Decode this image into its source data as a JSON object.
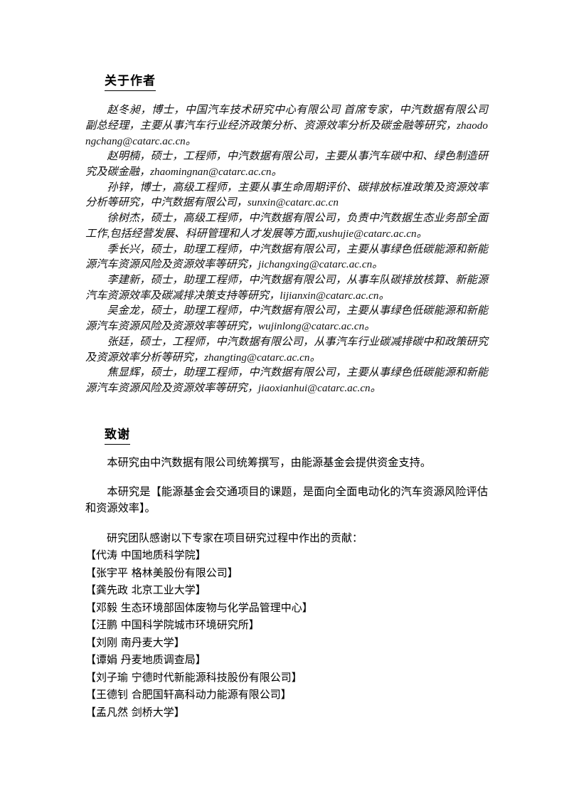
{
  "document": {
    "page_background": "#ffffff",
    "text_color": "#000000"
  },
  "about_authors": {
    "heading": "关于作者",
    "authors": [
      {
        "name": "赵冬昶",
        "text": "赵冬昶，博士，中国汽车技术研究中心有限公司 首席专家，中汽数据有限公司 副总经理，主要从事汽车行业经济政策分析、资源效率分析及碳金融等研究，zhaodongchang@catarc.ac.cn。"
      },
      {
        "name": "赵明楠",
        "text": "赵明楠，硕士，工程师，中汽数据有限公司，主要从事汽车碳中和、绿色制造研究及碳金融，zhaomingnan@catarc.ac.cn。"
      },
      {
        "name": "孙锌",
        "text": "孙锌，博士，高级工程师，主要从事生命周期评价、碳排放标准政策及资源效率分析等研究，中汽数据有限公司，sunxin@catarc.ac.cn"
      },
      {
        "name": "徐树杰",
        "text": "徐树杰，硕士，高级工程师，中汽数据有限公司，负责中汽数据生态业务部全面工作,包括经营发展、科研管理和人才发展等方面,xushujie@catarc.ac.cn。"
      },
      {
        "name": "季长兴",
        "text": "季长兴，硕士，助理工程师，中汽数据有限公司，主要从事绿色低碳能源和新能源汽车资源风险及资源效率等研究，jichangxing@catarc.ac.cn。"
      },
      {
        "name": "李建新",
        "text": "李建新，硕士，助理工程师，中汽数据有限公司，从事车队碳排放核算、新能源汽车资源效率及碳减排决策支持等研究，lijianxin@catarc.ac.cn。"
      },
      {
        "name": "吴金龙",
        "text": "吴金龙，硕士，助理工程师，中汽数据有限公司，主要从事绿色低碳能源和新能源汽车资源风险及资源效率等研究，wujinlong@catarc.ac.cn。"
      },
      {
        "name": "张廷",
        "text": "张廷，硕士，工程师，中汽数据有限公司，从事汽车行业碳减排碳中和政策研究及资源效率分析等研究，zhangting@catarc.ac.cn。"
      },
      {
        "name": "焦显辉",
        "text": "焦显辉，硕士，助理工程师，中汽数据有限公司，主要从事绿色低碳能源和新能源汽车资源风险及资源效率等研究，jiaoxianhui@catarc.ac.cn。"
      }
    ]
  },
  "acknowledgement": {
    "heading": "致谢",
    "paragraphs": [
      "本研究由中汽数据有限公司统筹撰写，由能源基金会提供资金支持。",
      "本研究是【能源基金会交通项目的课题，是面向全面电动化的汽车资源风险评估和资源效率】。"
    ],
    "experts_intro": "研究团队感谢以下专家在项目研究过程中作出的贡献：",
    "experts": [
      "【代涛  中国地质科学院】",
      "【张宇平  格林美股份有限公司】",
      "【龚先政  北京工业大学】",
      "【邓毅  生态环境部固体废物与化学品管理中心】",
      "【汪鹏  中国科学院城市环境研究所】",
      "【刘刚  南丹麦大学】",
      "【谭娟  丹麦地质调查局】",
      "【刘子瑜  宁德时代新能源科技股份有限公司】",
      "【王德钊  合肥国轩高科动力能源有限公司】",
      "【孟凡然  剑桥大学】"
    ]
  }
}
